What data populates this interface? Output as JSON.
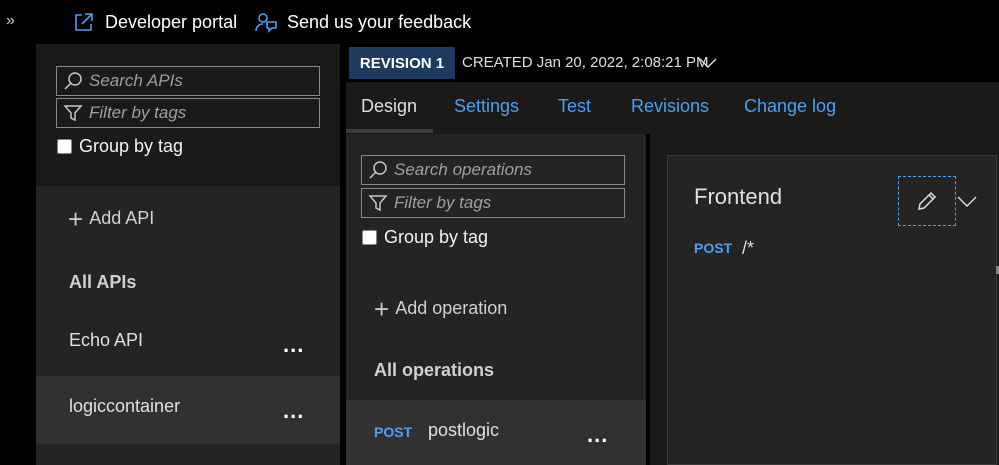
{
  "topbar": {
    "expand_icon": "double-chevron-right-icon",
    "developer_portal": "Developer portal",
    "feedback": "Send us your feedback"
  },
  "apis_panel": {
    "search_placeholder": "Search APIs",
    "filter_placeholder": "Filter by tags",
    "group_by_tag": "Group by tag",
    "add_api": "Add API",
    "all_apis": "All APIs",
    "items": [
      {
        "label": "Echo API",
        "selected": false
      },
      {
        "label": "logiccontainer",
        "selected": true
      }
    ],
    "more": "..."
  },
  "revision": {
    "badge": "REVISION 1",
    "created": "CREATED Jan 20, 2022, 2:08:21 PM"
  },
  "tabs": [
    {
      "label": "Design",
      "active": true
    },
    {
      "label": "Settings",
      "active": false
    },
    {
      "label": "Test",
      "active": false
    },
    {
      "label": "Revisions",
      "active": false
    },
    {
      "label": "Change log",
      "active": false
    }
  ],
  "operations_panel": {
    "search_placeholder": "Search operations",
    "filter_placeholder": "Filter by tags",
    "group_by_tag": "Group by tag",
    "add_operation": "Add operation",
    "all_operations": "All operations",
    "items": [
      {
        "method": "POST",
        "label": "postlogic"
      }
    ],
    "more": "..."
  },
  "frontend": {
    "title": "Frontend",
    "method": "POST",
    "path": "/*"
  },
  "colors": {
    "accent": "#4aa0f5",
    "background": "#1b1a19",
    "panel": "#252423",
    "badge": "#1e3a5f"
  }
}
